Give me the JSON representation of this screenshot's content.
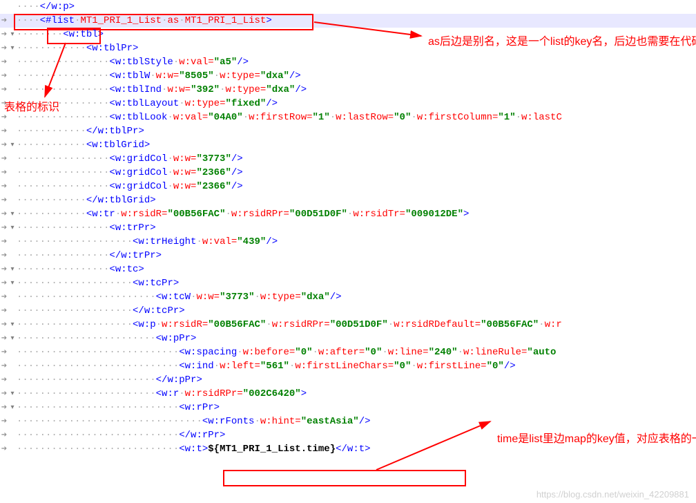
{
  "annotations": {
    "as_alias": "as后边是别名，这是一个list的key名，后边也需要在代码里映射对应的值",
    "table_marker": "表格的标识",
    "time_key": "time是list里边map的key值，对应表格的一列"
  },
  "watermark": "https://blog.csdn.net/weixin_42209881",
  "code": {
    "line0_close": "</w:p>",
    "line1_open": "<#list",
    "line1_a": "MT1_PRI_1_List",
    "line1_as": "as",
    "line1_b": "MT1_PRI_1_List",
    "line2": "<w:tbl>",
    "line3": "<w:tblPr>",
    "line4_tag": "<w:tblStyle",
    "line4_attr": "w:val=",
    "line4_val": "\"a5\"",
    "line4_end": "/>",
    "line5_tag": "<w:tblW",
    "line5_a1": "w:w=",
    "line5_v1": "\"8505\"",
    "line5_a2": "w:type=",
    "line5_v2": "\"dxa\"",
    "line5_end": "/>",
    "line6_tag": "<w:tblInd",
    "line6_a1": "w:w=",
    "line6_v1": "\"392\"",
    "line6_a2": "w:type=",
    "line6_v2": "\"dxa\"",
    "line6_end": "/>",
    "line7_tag": "<w:tblLayout",
    "line7_a1": "w:type=",
    "line7_v1": "\"fixed\"",
    "line7_end": "/>",
    "line8_tag": "<w:tblLook",
    "line8_a1": "w:val=",
    "line8_v1": "\"04A0\"",
    "line8_a2": "w:firstRow=",
    "line8_v2": "\"1\"",
    "line8_a3": "w:lastRow=",
    "line8_v3": "\"0\"",
    "line8_a4": "w:firstColumn=",
    "line8_v4": "\"1\"",
    "line8_a5": "w:lastC",
    "line9": "</w:tblPr>",
    "line10": "<w:tblGrid>",
    "line11_tag": "<w:gridCol",
    "line11_a": "w:w=",
    "line11_v": "\"3773\"",
    "line11_end": "/>",
    "line12_tag": "<w:gridCol",
    "line12_a": "w:w=",
    "line12_v": "\"2366\"",
    "line12_end": "/>",
    "line13_tag": "<w:gridCol",
    "line13_a": "w:w=",
    "line13_v": "\"2366\"",
    "line13_end": "/>",
    "line14": "</w:tblGrid>",
    "line15_tag": "<w:tr",
    "line15_a1": "w:rsidR=",
    "line15_v1": "\"00B56FAC\"",
    "line15_a2": "w:rsidRPr=",
    "line15_v2": "\"00D51D0F\"",
    "line15_a3": "w:rsidTr=",
    "line15_v3": "\"009012DE\"",
    "line15_end": ">",
    "line16": "<w:trPr>",
    "line17_tag": "<w:trHeight",
    "line17_a": "w:val=",
    "line17_v": "\"439\"",
    "line17_end": "/>",
    "line18": "</w:trPr>",
    "line19": "<w:tc>",
    "line20": "<w:tcPr>",
    "line21_tag": "<w:tcW",
    "line21_a1": "w:w=",
    "line21_v1": "\"3773\"",
    "line21_a2": "w:type=",
    "line21_v2": "\"dxa\"",
    "line21_end": "/>",
    "line22": "</w:tcPr>",
    "line23_tag": "<w:p",
    "line23_a1": "w:rsidR=",
    "line23_v1": "\"00B56FAC\"",
    "line23_a2": "w:rsidRPr=",
    "line23_v2": "\"00D51D0F\"",
    "line23_a3": "w:rsidRDefault=",
    "line23_v3": "\"00B56FAC\"",
    "line23_a4": "w:r",
    "line24": "<w:pPr>",
    "line25_tag": "<w:spacing",
    "line25_a1": "w:before=",
    "line25_v1": "\"0\"",
    "line25_a2": "w:after=",
    "line25_v2": "\"0\"",
    "line25_a3": "w:line=",
    "line25_v3": "\"240\"",
    "line25_a4": "w:lineRule=",
    "line25_v4": "\"auto",
    "line26_tag": "<w:ind",
    "line26_a1": "w:left=",
    "line26_v1": "\"561\"",
    "line26_a2": "w:firstLineChars=",
    "line26_v2": "\"0\"",
    "line26_a3": "w:firstLine=",
    "line26_v3": "\"0\"",
    "line26_end": "/>",
    "line27": "</w:pPr>",
    "line28_tag": "<w:r",
    "line28_a": "w:rsidRPr=",
    "line28_v": "\"002C6420\"",
    "line28_end": ">",
    "line29": "<w:rPr>",
    "line30_tag": "<w:rFonts",
    "line30_a": "w:hint=",
    "line30_v": "\"eastAsia\"",
    "line30_end": "/>",
    "line31": "</w:rPr>",
    "line32_open": "<w:t>",
    "line32_txt": "${MT1_PRI_1_List.time}",
    "line32_close": "</w:t>"
  }
}
